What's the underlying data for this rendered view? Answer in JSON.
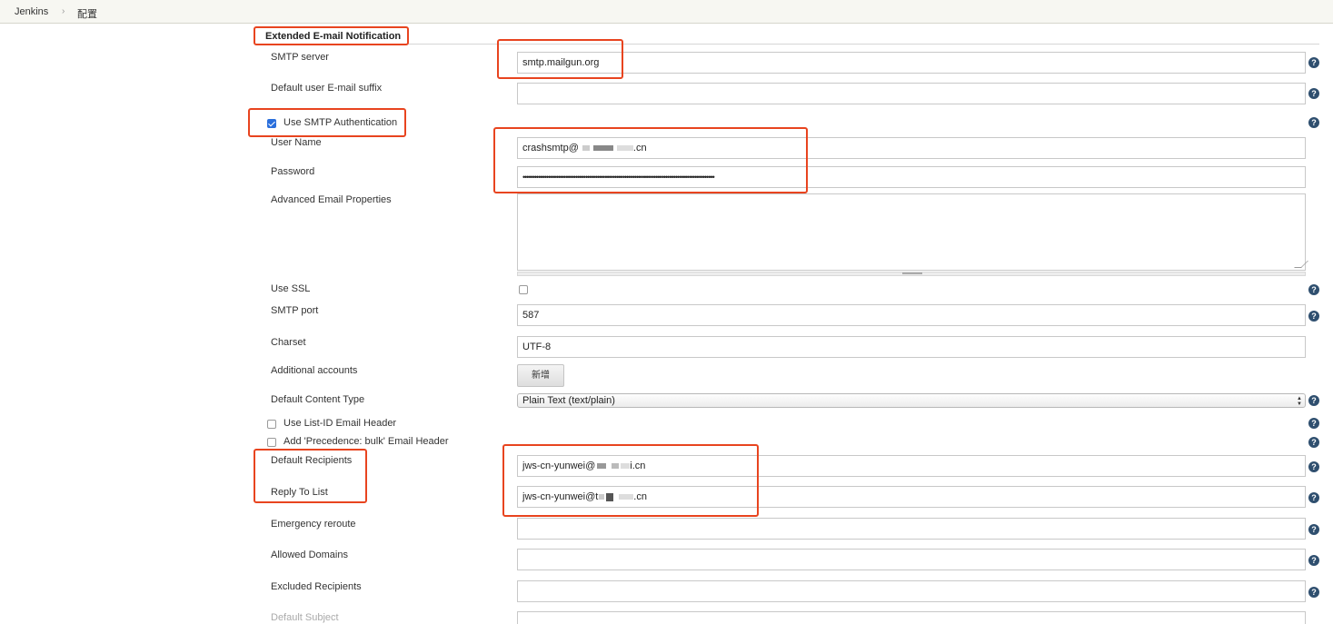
{
  "breadcrumb": {
    "root": "Jenkins",
    "separator": "›",
    "current": "配置"
  },
  "section": {
    "title": "Extended E-mail Notification"
  },
  "fields": {
    "smtp_server": {
      "label": "SMTP server",
      "value": "smtp.mailgun.org"
    },
    "default_suffix": {
      "label": "Default user E-mail suffix",
      "value": ""
    },
    "use_smtp_auth": {
      "label": "Use SMTP Authentication",
      "checked": true
    },
    "user_name": {
      "label": "User Name",
      "value_prefix": "crashsmtp@",
      "value_suffix": ".cn"
    },
    "password": {
      "label": "Password",
      "value": "••••••••••••••••••••••••••••••••••••••••••••••••••••••••••••••••••••••••••••••••••••••••••••••••••"
    },
    "advanced_props": {
      "label": "Advanced Email Properties",
      "value": ""
    },
    "use_ssl": {
      "label": "Use SSL",
      "checked": false
    },
    "smtp_port": {
      "label": "SMTP port",
      "value": "587"
    },
    "charset": {
      "label": "Charset",
      "value": "UTF-8"
    },
    "additional_accounts": {
      "label": "Additional accounts",
      "button": "新增"
    },
    "content_type": {
      "label": "Default Content Type",
      "value": "Plain Text (text/plain)"
    },
    "list_id_header": {
      "label": "Use List-ID Email Header",
      "checked": false
    },
    "precedence_header": {
      "label": "Add 'Precedence: bulk' Email Header",
      "checked": false
    },
    "default_recipients": {
      "label": "Default Recipients",
      "value_prefix": "jws-cn-yunwei@",
      "value_suffix": "i.cn"
    },
    "reply_to": {
      "label": "Reply To List",
      "value_prefix": "jws-cn-yunwei@t",
      "value_suffix": ".cn"
    },
    "emergency_reroute": {
      "label": "Emergency reroute",
      "value": ""
    },
    "allowed_domains": {
      "label": "Allowed Domains",
      "value": ""
    },
    "excluded_recipients": {
      "label": "Excluded Recipients",
      "value": ""
    },
    "default_subject": {
      "label": "Default Subject"
    }
  },
  "help_glyph": "?",
  "colors": {
    "annotation": "#e8441f",
    "help_icon": "#2f4f6f",
    "checkbox_checked": "#2a6fdc"
  }
}
